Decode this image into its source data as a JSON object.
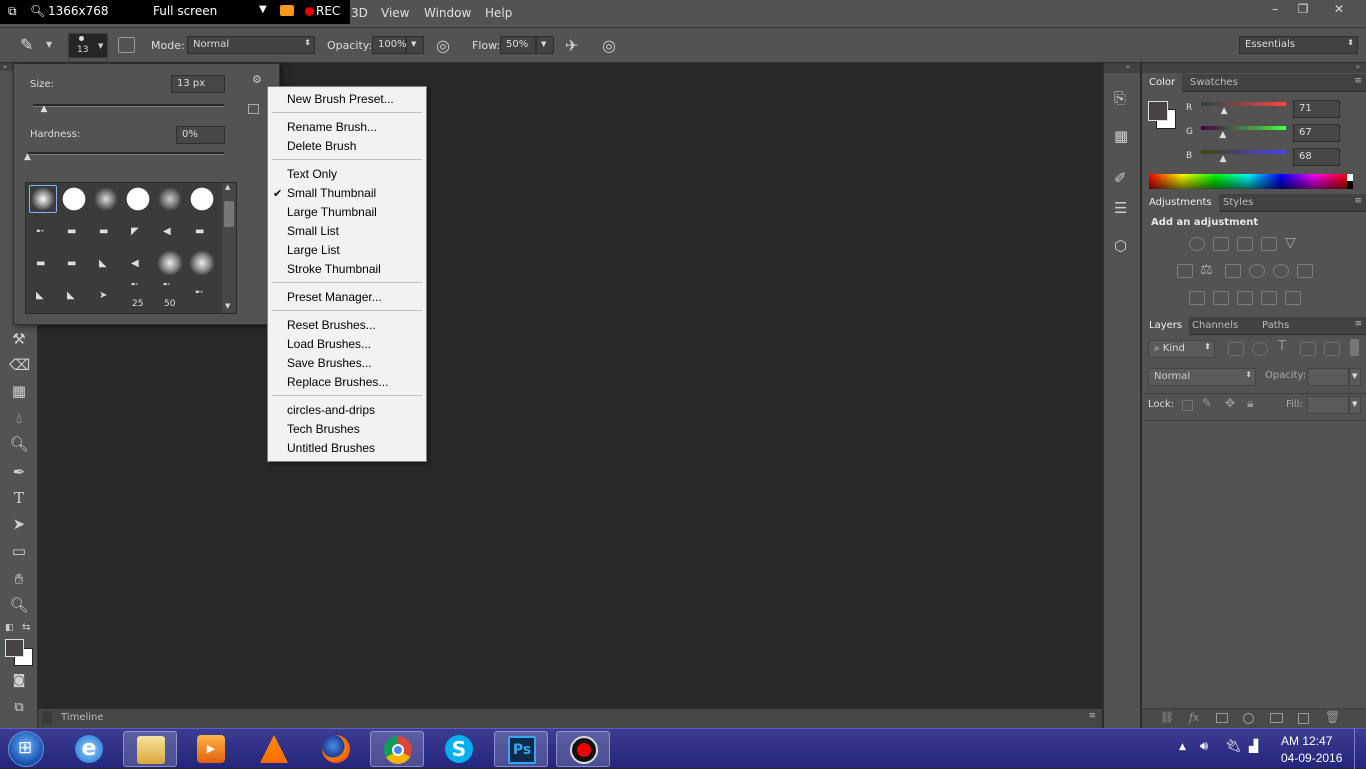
{
  "recorder": {
    "resolution": "1366x768",
    "mode": "Full screen",
    "rec_label": "REC"
  },
  "menubar": {
    "items": [
      "3D",
      "View",
      "Window",
      "Help"
    ]
  },
  "window_controls": {
    "minimize": "–",
    "restore": "❐",
    "close": "✕"
  },
  "options": {
    "brush_size": "13",
    "mode_label": "Mode:",
    "mode_value": "Normal",
    "opacity_label": "Opacity:",
    "opacity_value": "100%",
    "flow_label": "Flow:",
    "flow_value": "50%",
    "workspace": "Essentials"
  },
  "brush_picker": {
    "size_label": "Size:",
    "size_value": "13 px",
    "hardness_label": "Hardness:",
    "hardness_value": "0%",
    "size_level": 0.06,
    "hardness_level": 0.0,
    "thumb_numbers": [
      "25",
      "50"
    ]
  },
  "context_menu": {
    "items": [
      {
        "label": "New Brush Preset...",
        "checked": false
      },
      {
        "label": "Rename Brush...",
        "checked": false
      },
      {
        "label": "Delete Brush",
        "checked": false
      },
      {
        "label": "Text Only",
        "checked": false
      },
      {
        "label": "Small Thumbnail",
        "checked": true
      },
      {
        "label": "Large Thumbnail",
        "checked": false
      },
      {
        "label": "Small List",
        "checked": false
      },
      {
        "label": "Large List",
        "checked": false
      },
      {
        "label": "Stroke Thumbnail",
        "checked": false
      },
      {
        "label": "Preset Manager...",
        "checked": false
      },
      {
        "label": "Reset Brushes...",
        "checked": false
      },
      {
        "label": "Load Brushes...",
        "checked": false
      },
      {
        "label": "Save Brushes...",
        "checked": false
      },
      {
        "label": "Replace Brushes...",
        "checked": false
      },
      {
        "label": "circles-and-drips",
        "checked": false
      },
      {
        "label": "Tech Brushes",
        "checked": false
      },
      {
        "label": "Untitled Brushes",
        "checked": false
      }
    ]
  },
  "color_panel": {
    "tabs": [
      "Color",
      "Swatches"
    ],
    "r_label": "R",
    "g_label": "G",
    "b_label": "B",
    "r": "71",
    "g": "67",
    "b": "68"
  },
  "adjustments_panel": {
    "tabs": [
      "Adjustments",
      "Styles"
    ],
    "heading": "Add an adjustment"
  },
  "layers_panel": {
    "tabs": [
      "Layers",
      "Channels",
      "Paths"
    ],
    "kind_label": "Kind",
    "blend_mode": "Normal",
    "opacity_label": "Opacity:",
    "lock_label": "Lock:",
    "fill_label": "Fill:"
  },
  "timeline": {
    "label": "Timeline"
  },
  "taskbar": {
    "time": "AM 12:47",
    "date": "04-09-2016"
  },
  "colors": {
    "accent": "#2a7de1",
    "menu_bg": "#f2f2f2",
    "panel": "#535353",
    "canvas": "#282828"
  }
}
